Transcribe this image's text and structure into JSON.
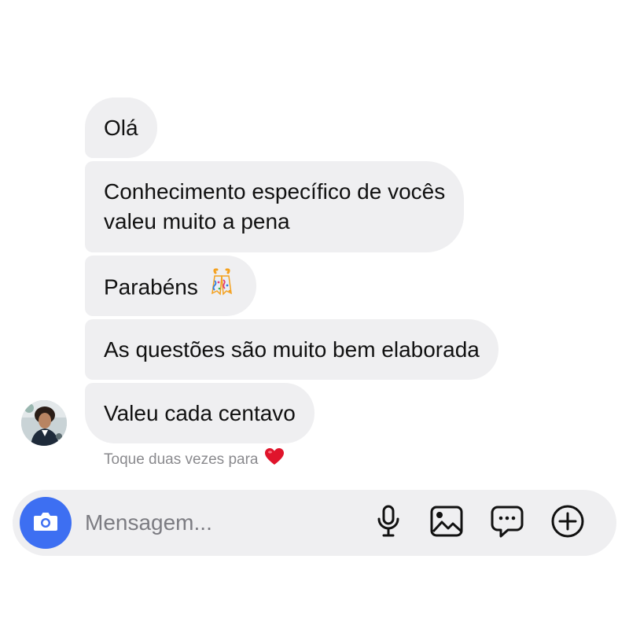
{
  "messages": [
    {
      "text": "Olá"
    },
    {
      "lines": [
        "Conhecimento específico de vocês",
        "valeu muito a pena"
      ]
    },
    {
      "text": "Parabéns",
      "emoji": "party-popper-icon"
    },
    {
      "text": "As questões são muito bem elaborada"
    },
    {
      "text": "Valeu cada centavo"
    }
  ],
  "hint": {
    "text": "Toque duas vezes para",
    "icon": "heart-icon",
    "color": "#e0142b"
  },
  "composer": {
    "placeholder": "Mensagem...",
    "value": "",
    "camera_color": "#3d6ff2",
    "icons": [
      "camera-icon",
      "microphone-icon",
      "image-icon",
      "sticker-message-icon",
      "add-icon"
    ]
  },
  "colors": {
    "bubble": "#efeff1",
    "background": "#ffffff",
    "text": "#111111",
    "muted": "#8a8a8e"
  }
}
